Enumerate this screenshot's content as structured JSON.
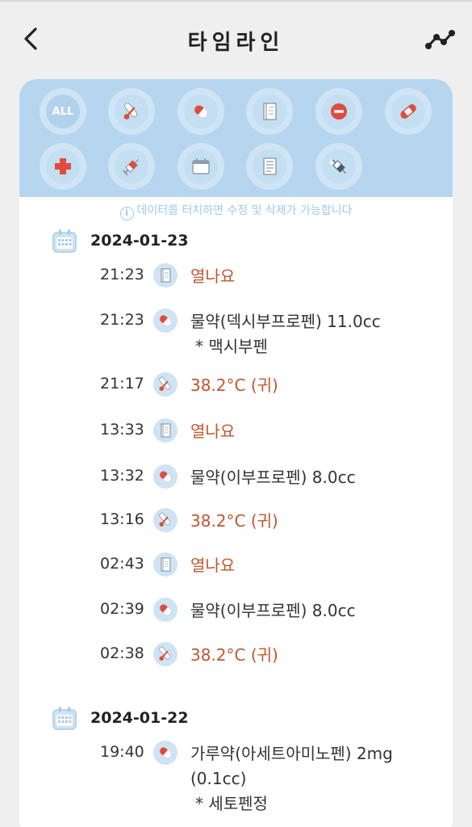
{
  "header": {
    "title": "타임라인",
    "back_icon": "chevron-left-icon",
    "chart_icon": "line-chart-icon"
  },
  "filters": [
    {
      "id": "all",
      "label": "ALL",
      "icon": "all-icon"
    },
    {
      "id": "temperature",
      "icon": "thermometer-icon"
    },
    {
      "id": "medicine",
      "icon": "pill-icon"
    },
    {
      "id": "memo",
      "icon": "notebook-icon"
    },
    {
      "id": "block",
      "icon": "no-entry-icon"
    },
    {
      "id": "bandage",
      "icon": "bandage-icon"
    },
    {
      "id": "hospital",
      "icon": "medical-cross-icon"
    },
    {
      "id": "injection",
      "icon": "syringe-icon"
    },
    {
      "id": "schedule",
      "icon": "calendar-icon"
    },
    {
      "id": "record",
      "icon": "document-icon"
    },
    {
      "id": "vaccine",
      "icon": "vaccine-icon"
    }
  ],
  "hint": "데이터를 터치하면 수정 및 삭제가 가능합니다",
  "colors": {
    "accent_blue": "#b6d6ef",
    "orange_text": "#c0562f"
  },
  "days": [
    {
      "date": "2024-01-23",
      "entries": [
        {
          "time": "21:23",
          "type": "memo",
          "text": "열나요",
          "sub": ""
        },
        {
          "time": "21:23",
          "type": "medicine",
          "text": "물약(덱시부프로펜) 11.0cc",
          "sub": "* 맥시부펜"
        },
        {
          "time": "21:17",
          "type": "temperature",
          "text": "38.2°C (귀)",
          "sub": ""
        },
        {
          "time": "13:33",
          "type": "memo",
          "text": "열나요",
          "sub": ""
        },
        {
          "time": "13:32",
          "type": "medicine",
          "text": "물약(이부프로펜) 8.0cc",
          "sub": ""
        },
        {
          "time": "13:16",
          "type": "temperature",
          "text": "38.2°C (귀)",
          "sub": ""
        },
        {
          "time": "02:43",
          "type": "memo",
          "text": "열나요",
          "sub": ""
        },
        {
          "time": "02:39",
          "type": "medicine",
          "text": "물약(이부프로펜) 8.0cc",
          "sub": ""
        },
        {
          "time": "02:38",
          "type": "temperature",
          "text": "38.2°C (귀)",
          "sub": ""
        }
      ]
    },
    {
      "date": "2024-01-22",
      "entries": [
        {
          "time": "19:40",
          "type": "medicine",
          "text": "가루약(아세트아미노펜) 2mg (0.1cc)",
          "sub": "* 세토펜정"
        }
      ]
    }
  ]
}
